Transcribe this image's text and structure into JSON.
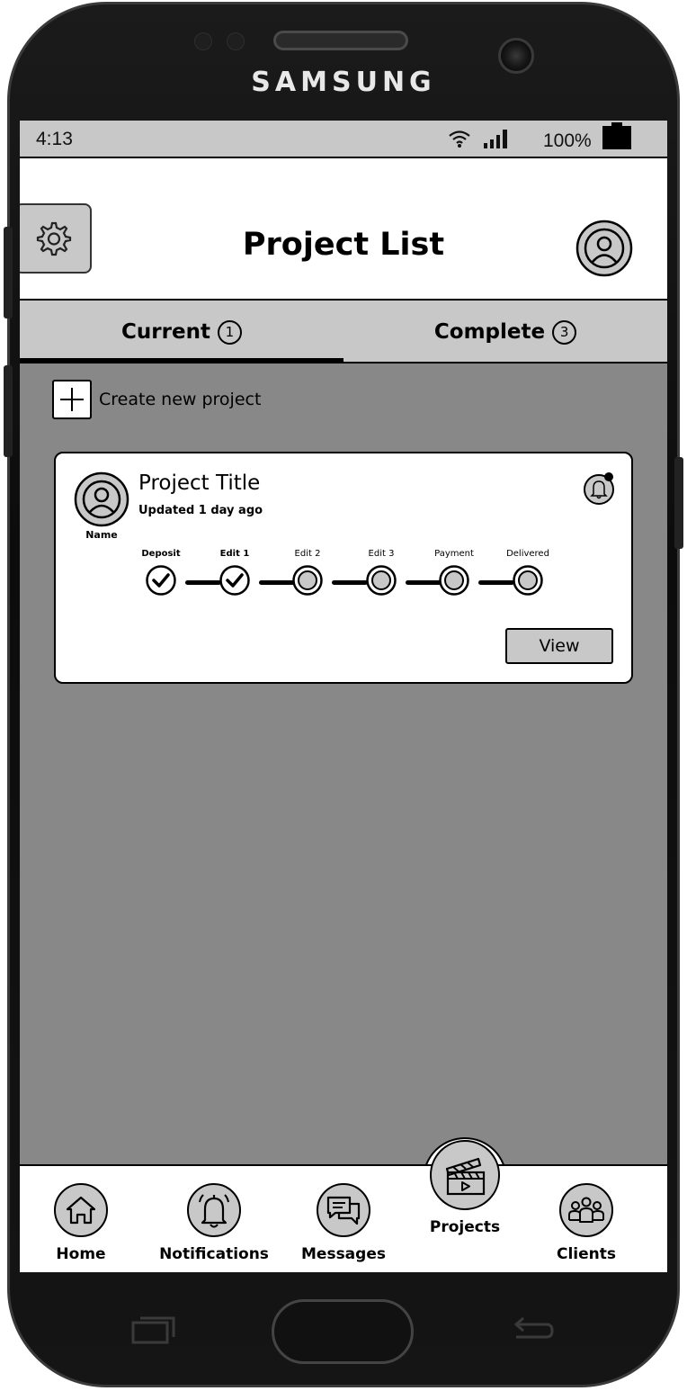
{
  "device": {
    "brand": "SAMSUNG"
  },
  "status_bar": {
    "time": "4:13",
    "battery": "100%",
    "icons": [
      "wifi-icon",
      "signal-icon",
      "battery-icon"
    ]
  },
  "header": {
    "title": "Project List",
    "left_icon": "gear-icon",
    "right_icon": "user-icon"
  },
  "tabs": [
    {
      "label": "Current",
      "count": "1",
      "active": true
    },
    {
      "label": "Complete",
      "count": "3",
      "active": false
    }
  ],
  "create_project": {
    "label": "Create new project",
    "icon": "plus-icon"
  },
  "project_card": {
    "title": "Project Title",
    "updated": "Updated 1 day ago",
    "avatar_name": "Name",
    "notification_icon": "bell-icon",
    "view_label": "View",
    "steps": [
      {
        "label": "Deposit",
        "done": true
      },
      {
        "label": "Edit 1",
        "done": true
      },
      {
        "label": "Edit 2",
        "done": false
      },
      {
        "label": "Edit 3",
        "done": false
      },
      {
        "label": "Payment",
        "done": false
      },
      {
        "label": "Delivered",
        "done": false
      }
    ]
  },
  "bottom_nav": [
    {
      "label": "Home",
      "icon": "home-icon"
    },
    {
      "label": "Notifications",
      "icon": "bell-icon"
    },
    {
      "label": "Messages",
      "icon": "chat-icon"
    },
    {
      "label": "Projects",
      "icon": "clapperboard-icon",
      "active": true
    },
    {
      "label": "Clients",
      "icon": "group-icon"
    }
  ],
  "colors": {
    "background": "#888888",
    "panel": "#c8c8c8",
    "surface": "#ffffff",
    "ink": "#000000"
  }
}
